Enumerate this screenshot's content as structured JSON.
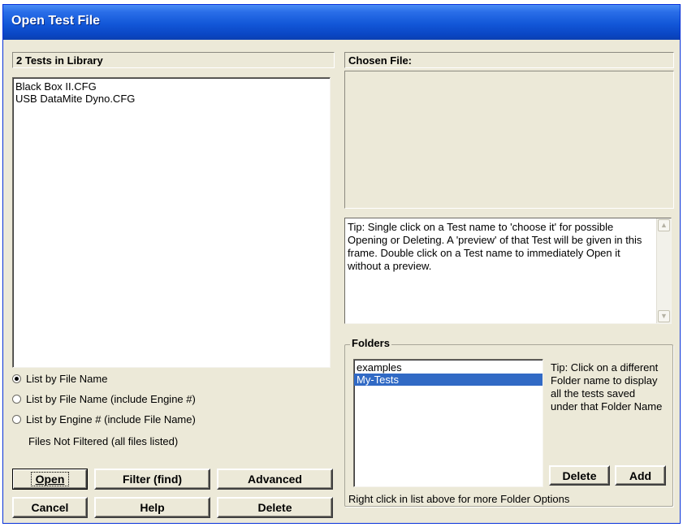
{
  "window": {
    "title": "Open Test File"
  },
  "library": {
    "header": "2 Tests in Library",
    "files": [
      "Black Box II.CFG",
      "USB DataMite Dyno.CFG"
    ]
  },
  "chosen": {
    "header": "Chosen File:",
    "tip": "Tip: Single click on a Test name to 'choose it' for possible Opening or Deleting. A 'preview' of that Test will be given in this frame.  Double click on a Test name to immediately Open it without a preview."
  },
  "sort_options": {
    "items": [
      {
        "label": "List by File Name",
        "checked": true
      },
      {
        "label": "List by File Name (include Engine #)",
        "checked": false
      },
      {
        "label": "List by Engine # (include File Name)",
        "checked": false
      }
    ],
    "status": "Files Not Filtered (all files listed)"
  },
  "folders": {
    "label": "Folders",
    "items": [
      {
        "name": "examples",
        "selected": false
      },
      {
        "name": "My-Tests",
        "selected": true
      }
    ],
    "tip": "Tip:  Click on a different Folder name to display all the tests saved under that Folder Name",
    "delete_label": "Delete",
    "add_label": "Add",
    "hint": "Right click in list above for more Folder Options"
  },
  "buttons": {
    "open": "Open",
    "filter": "Filter (find)",
    "advanced": "Advanced",
    "cancel": "Cancel",
    "help": "Help",
    "delete": "Delete"
  },
  "icons": {
    "scroll_up": "scroll-up-icon",
    "scroll_down": "scroll-down-icon"
  }
}
